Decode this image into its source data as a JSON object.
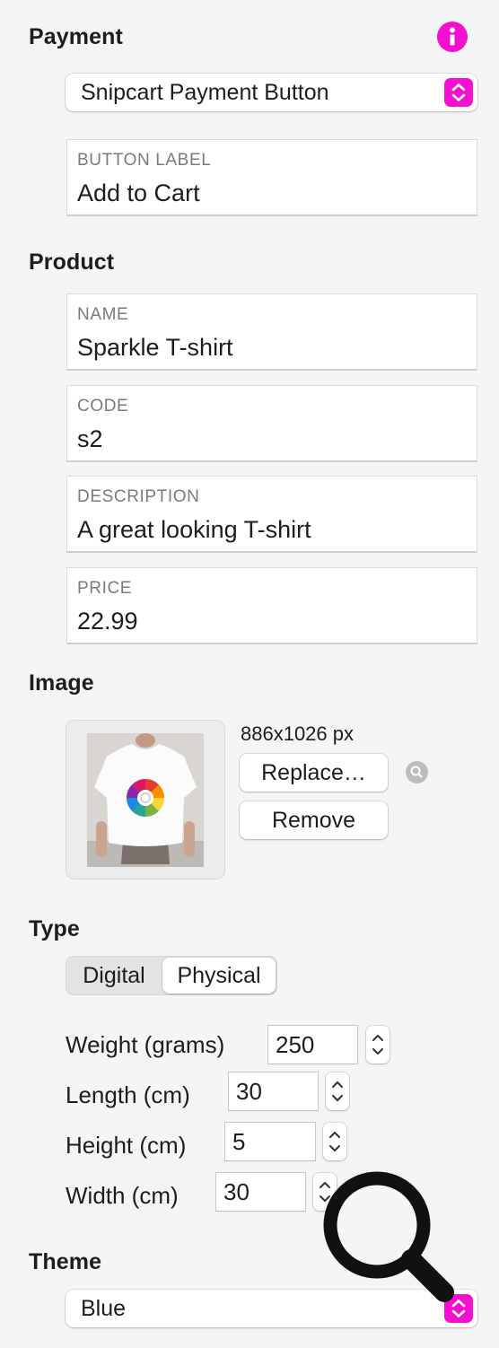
{
  "payment": {
    "title": "Payment",
    "provider_value": "Snipcart Payment Button",
    "button_label": {
      "label": "BUTTON LABEL",
      "value": "Add to Cart"
    }
  },
  "product": {
    "title": "Product",
    "fields": [
      {
        "label": "NAME",
        "value": "Sparkle T-shirt"
      },
      {
        "label": "CODE",
        "value": "s2"
      },
      {
        "label": "DESCRIPTION",
        "value": "A great looking T-shirt"
      },
      {
        "label": "PRICE",
        "value": "22.99"
      }
    ]
  },
  "image": {
    "title": "Image",
    "dimensions": "886x1026 px",
    "replace_label": "Replace…",
    "remove_label": "Remove"
  },
  "type": {
    "title": "Type",
    "options": [
      "Digital",
      "Physical"
    ],
    "selected": "Physical",
    "dimensions": [
      {
        "label": "Weight (grams)",
        "value": "250"
      },
      {
        "label": "Length (cm)",
        "value": "30"
      },
      {
        "label": "Height (cm)",
        "value": "5"
      },
      {
        "label": "Width (cm)",
        "value": "30"
      }
    ]
  },
  "theme": {
    "title": "Theme",
    "value": "Blue"
  },
  "icons": {
    "info": "info-icon",
    "select_stepper": "chevron-up-down-icon",
    "zoom": "magnifying-glass-icon",
    "overlay": "magnifying-glass-icon"
  },
  "colors": {
    "accent": "#f50fd0",
    "background": "#f5f5f5"
  }
}
